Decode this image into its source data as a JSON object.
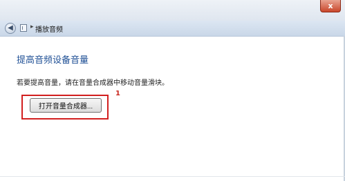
{
  "window": {
    "close_glyph": "x"
  },
  "navbar": {
    "back_glyph": "◀",
    "crumb_arrow": "▸",
    "breadcrumb": "播放音频"
  },
  "content": {
    "title": "提高音频设备音量",
    "description": "若要提高音量，请在音量合成器中移动音量滑块。",
    "button_label": "打开音量合成器...",
    "step_number": "1"
  },
  "colors": {
    "title": "#1e4f95",
    "highlight": "#d21f1f",
    "step_number": "#c8261d"
  }
}
